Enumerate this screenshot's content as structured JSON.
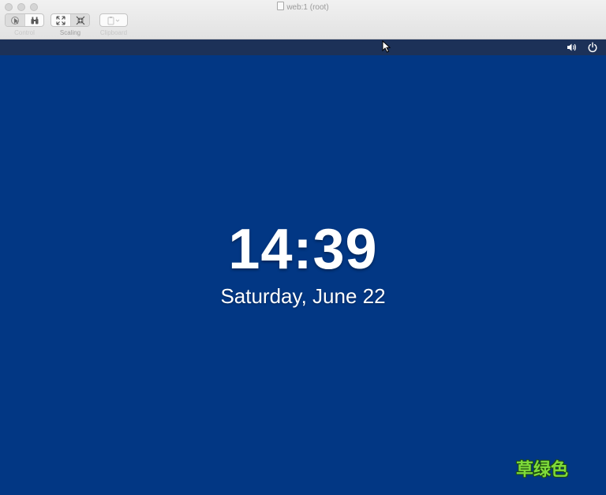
{
  "window": {
    "title": "web:1 (root)"
  },
  "toolbar": {
    "control_label": "Control",
    "scaling_label": "Scaling",
    "clipboard_label": "Clipboard"
  },
  "lockscreen": {
    "time": "14:39",
    "date": "Saturday, June 22",
    "background_color": "#023784",
    "topbar_color": "#1c3158"
  },
  "status": {
    "volume_icon": "volume-icon",
    "power_icon": "power-icon"
  },
  "watermark": {
    "text": "草绿色",
    "color": "#7fdc3a"
  }
}
